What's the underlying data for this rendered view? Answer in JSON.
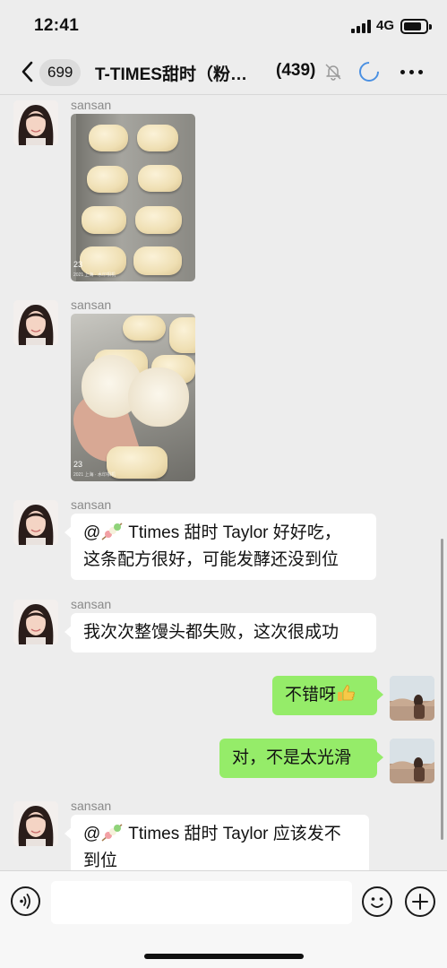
{
  "status_bar": {
    "time": "12:41",
    "network": "4G"
  },
  "nav": {
    "unread_count": "699",
    "title": "T-TIMES甜时（粉…",
    "member_count": "(439)"
  },
  "messages": [
    {
      "type": "image",
      "sender": "sansan",
      "photo_stamp": "23",
      "photo_caption": "2021 上海 · 水印相机"
    },
    {
      "type": "image",
      "sender": "sansan",
      "photo_stamp": "23",
      "photo_caption": "2021 上海 · 水印相机"
    },
    {
      "type": "text",
      "sender": "sansan",
      "mention": "@",
      "text_line1": " Ttimes 甜时 Taylor 好好吃，",
      "text_line2": "这条配方很好，可能发酵还没到位"
    },
    {
      "type": "text",
      "sender": "sansan",
      "text": "我次次整馒头都失败，这次很成功"
    },
    {
      "type": "self",
      "text": "不错呀"
    },
    {
      "type": "self",
      "text": "对，不是太光滑"
    },
    {
      "type": "text",
      "sender": "sansan",
      "mention": "@",
      "text_line1": " Ttimes 甜时 Taylor 应该发不",
      "text_line2": "到位"
    }
  ],
  "input": {
    "placeholder": ""
  },
  "icons": {
    "back": "chevron-left-icon",
    "mute": "bell-off-icon",
    "loading": "loading-spinner-icon",
    "more": "more-dots-icon",
    "voice": "voice-icon",
    "emoji": "emoji-icon",
    "plus": "plus-icon",
    "skewer": "skewer-emoji-icon",
    "thumb": "thumbs-up-emoji-icon"
  },
  "colors": {
    "self_bubble": "#95ec69",
    "other_bubble": "#ffffff",
    "background": "#ededed",
    "accent_spinner": "#4a90e2"
  }
}
